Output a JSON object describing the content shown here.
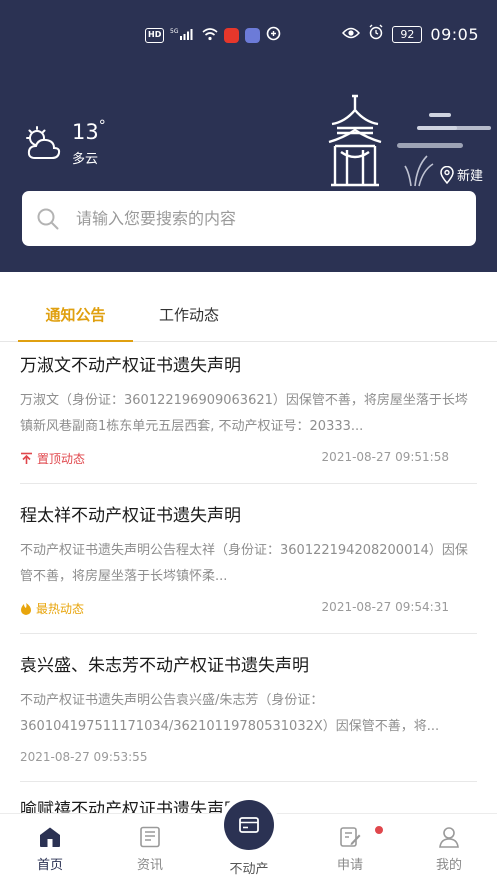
{
  "status_bar": {
    "hd": "HD",
    "net": "5G",
    "battery": "92",
    "time": "09:05"
  },
  "weather": {
    "temp": "13",
    "unit": "°",
    "desc": "多云",
    "icon": "cloud-sun-icon"
  },
  "location": {
    "name": "新建"
  },
  "search": {
    "placeholder": "请输入您要搜索的内容"
  },
  "tabs": [
    {
      "label": "通知公告",
      "active": true
    },
    {
      "label": "工作动态",
      "active": false
    }
  ],
  "news": [
    {
      "title": "万淑文不动产权证书遗失声明",
      "body": "万淑文（身份证：360122196909063621）因保管不善，将房屋坐落于长埁镇新风巷副商1栋东单元五层西套, 不动产权证号：20333...",
      "tag": "置顶动态",
      "tag_icon": "pin-top-icon",
      "date": "2021-08-27 09:51:58"
    },
    {
      "title": "程太祥不动产权证书遗失声明",
      "body": "不动产权证书遗失声明公告程太祥（身份证：360122194208200014）因保管不善，将房屋坐落于长埁镇怀柔...",
      "tag": "最热动态",
      "tag_icon": "fire-icon",
      "date": "2021-08-27 09:54:31"
    },
    {
      "title": "袁兴盛、朱志芳不动产权证书遗失声明",
      "body": "不动产权证书遗失声明公告袁兴盛/朱志芳（身份证：360104197511171034/36210119780531032X）因保管不善，将...",
      "tag": "",
      "date": "2021-08-27 09:53:55"
    },
    {
      "title": "喻赋禧不动产权证书遗失声明"
    }
  ],
  "nav": [
    {
      "label": "首页",
      "icon": "home-icon",
      "active": true
    },
    {
      "label": "资讯",
      "icon": "news-icon",
      "active": false
    },
    {
      "label": "不动产",
      "icon": "card-icon",
      "active": false
    },
    {
      "label": "申请",
      "icon": "edit-form-icon",
      "active": false
    },
    {
      "label": "我的",
      "icon": "user-icon",
      "active": false
    }
  ],
  "colors": {
    "header_bg": "#2b3253",
    "accent": "#e0a010",
    "tag_red": "#e0474c",
    "tag_gold": "#e8a50c"
  }
}
